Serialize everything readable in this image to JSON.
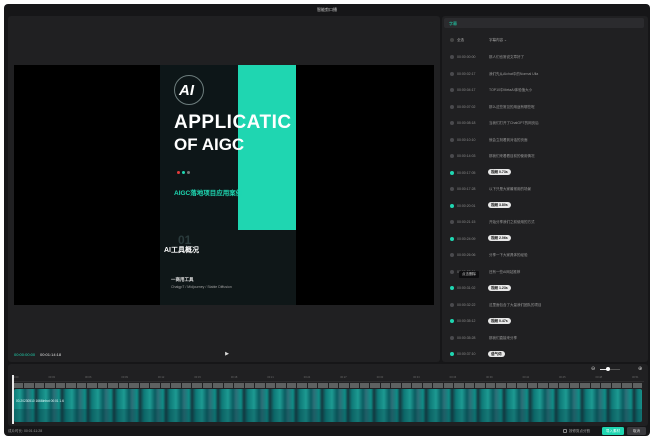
{
  "window": {
    "title": "智能剪口播"
  },
  "player": {
    "current_time": "00:00:00:00",
    "total_time": "00:01:14:18",
    "video": {
      "logo_text": "AI",
      "headline_1": "APPLICATIC",
      "headline_2": "OF AIGC",
      "subheadline": "AIGC落地项目应用案例",
      "section_number": "01",
      "section_title": "AI工具概况",
      "tool_title": "一商用工具",
      "tool_subtitle": "ChatgpT / Midjourney / Stable Diffusion"
    }
  },
  "subtitles": {
    "tab_label": "字幕",
    "header": {
      "select_all": "全选",
      "content": "字幕内容 ⌄"
    },
    "tooltip": "点击删除",
    "rows": [
      {
        "time": "00:00:00:00",
        "text": "那人们也常说文章好了",
        "active": false,
        "badge": false
      },
      {
        "time": "00:00:02:17",
        "text": "我们先从AIchat中的Normal Ulla",
        "active": false,
        "badge": false
      },
      {
        "time": "00:00:04:17",
        "text": "TOP10中MetaAI体验值大小",
        "active": false,
        "badge": false
      },
      {
        "time": "00:00:07:02",
        "text": "那么这些常见的用途有哪些呢",
        "active": false,
        "badge": false
      },
      {
        "time": "00:00:08:18",
        "text": "当我们打开了ChatGPT的网页后",
        "active": false,
        "badge": false
      },
      {
        "time": "00:00:10:10",
        "text": "就会立刻看到对话的页面",
        "active": false,
        "badge": false
      },
      {
        "time": "00:00:14:03",
        "text": "那我们来看看目前的使用情况",
        "active": false,
        "badge": false
      },
      {
        "time": "00:00:17:05",
        "text": "视频 0.73s",
        "active": true,
        "badge": true
      },
      {
        "time": "00:00:17:28",
        "text": "以下只是大家最常用的场景",
        "active": false,
        "badge": false
      },
      {
        "time": "00:00:20:01",
        "text": "视频 3.80s",
        "active": true,
        "badge": true
      },
      {
        "time": "00:00:21:15",
        "text": "开始分享我们之前使用的方式",
        "active": false,
        "badge": false
      },
      {
        "time": "00:00:24:09",
        "text": "视频 2.06s",
        "active": true,
        "badge": true
      },
      {
        "time": "00:00:26:06",
        "text": "分享一下大家具体的经验",
        "active": false,
        "badge": false
      },
      {
        "time": "00:00:28:04",
        "text": "还有一些AI网站推荐",
        "active": false,
        "badge": false
      },
      {
        "time": "00:00:31:02",
        "text": "视频 1.23s",
        "active": true,
        "badge": true
      },
      {
        "time": "00:00:32:22",
        "text": "这里面包含了大量我们团队的项目",
        "active": false,
        "badge": false
      },
      {
        "time": "00:00:35:12",
        "text": "视频 0.47s",
        "active": true,
        "badge": true
      },
      {
        "time": "00:00:35:28",
        "text": "那我们直接来分享",
        "active": false,
        "badge": false
      },
      {
        "time": "00:00:37:10",
        "text": "语气词",
        "active": true,
        "badge": true
      }
    ]
  },
  "timeline": {
    "zoom_out_icon": "⊖",
    "zoom_in_icon": "⊕",
    "ruler_labels": [
      "00:00",
      "00:03",
      "00:06",
      "00:09",
      "00:12",
      "00:15",
      "00:18",
      "00:21",
      "00:24",
      "00:27",
      "00:30",
      "00:33",
      "00:36",
      "00:39",
      "00:42",
      "00:45",
      "00:48",
      "00:51"
    ],
    "clip_label": "00.20230510 1666Inhot  00:01  1.6"
  },
  "footer": {
    "duration": "成片时长: 00:01:11:28",
    "checkbox_label": "按修剪点分割",
    "primary_button": "导入素材",
    "secondary_button": "取消"
  },
  "colors": {
    "accent": "#1fd6b1",
    "background": "#161618",
    "panel": "#202022"
  }
}
